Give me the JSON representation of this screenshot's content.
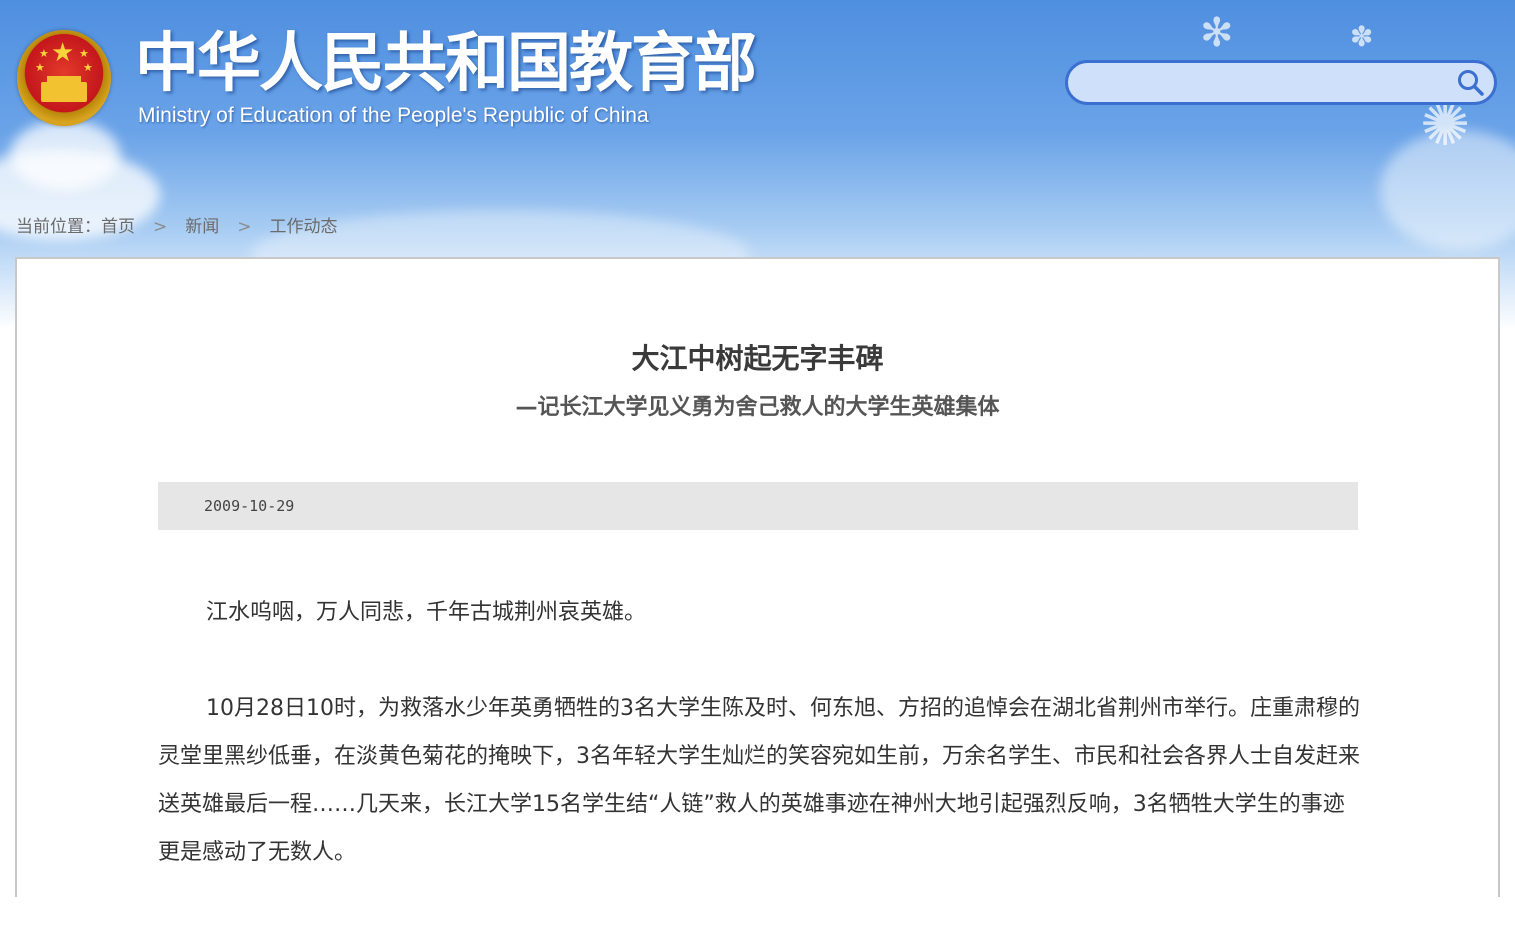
{
  "header": {
    "site_title_cn": "中华人民共和国教育部",
    "site_title_en": "Ministry of Education of the People's Republic of China",
    "emblem_icon": "national-emblem-icon",
    "accent_color": "#3b6fd0"
  },
  "search": {
    "placeholder": "",
    "value": "",
    "icon": "search-icon"
  },
  "breadcrumb": {
    "prefix": "当前位置：",
    "items": [
      "首页",
      "新闻",
      "工作动态"
    ],
    "separator": ">"
  },
  "article": {
    "title": "大江中树起无字丰碑",
    "subtitle": "—记长江大学见义勇为舍己救人的大学生英雄集体",
    "date": "2009-10-29",
    "paragraphs": [
      "江水呜咽，万人同悲，千年古城荆州哀英雄。",
      "10月28日10时，为救落水少年英勇牺牲的3名大学生陈及时、何东旭、方招的追悼会在湖北省荆州市举行。庄重肃穆的灵堂里黑纱低垂，在淡黄色菊花的掩映下，3名年轻大学生灿烂的笑容宛如生前，万余名学生、市民和社会各界人士自发赶来送英雄最后一程……几天来，长江大学15名学生结“人链”救人的英雄事迹在神州大地引起强烈反响，3名牺牲大学生的事迹更是感动了无数人。"
    ]
  }
}
